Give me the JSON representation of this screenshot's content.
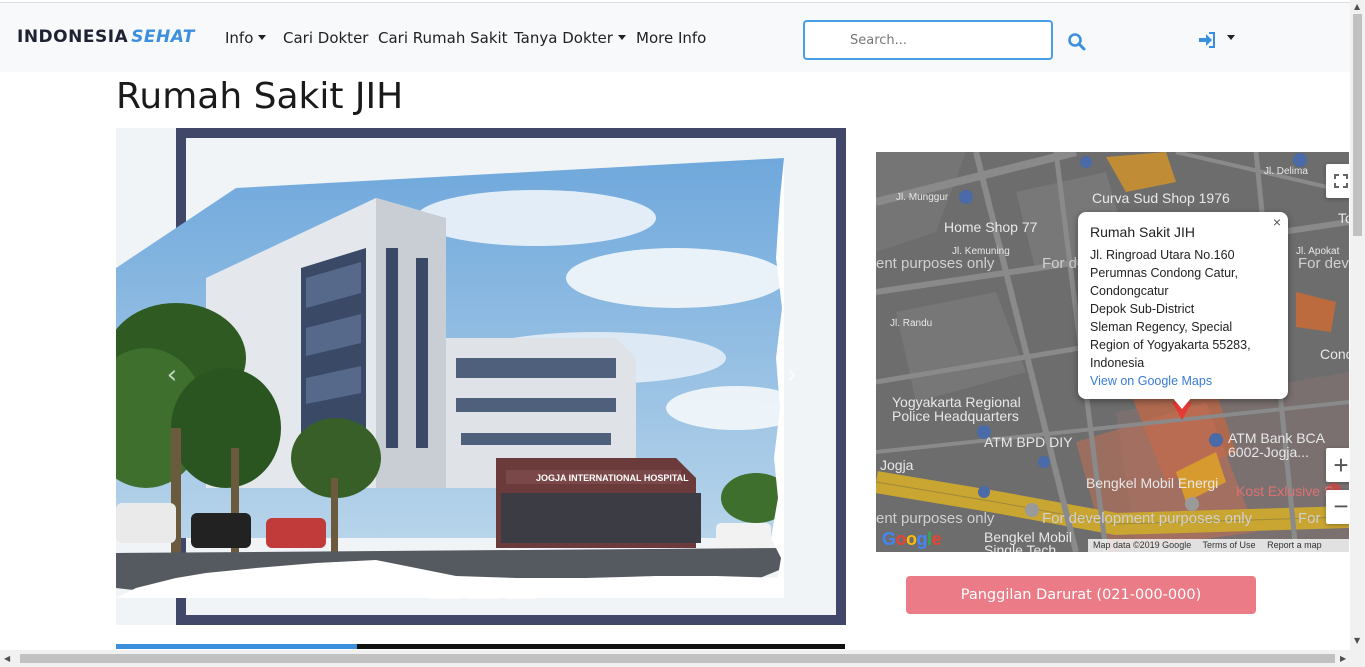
{
  "navbar": {
    "brand_part1": "INDONESIA",
    "brand_part2": "SEHAT",
    "items": [
      {
        "label": "Info",
        "dropdown": true
      },
      {
        "label": "Cari Dokter",
        "dropdown": false
      },
      {
        "label": "Cari Rumah Sakit",
        "dropdown": false
      },
      {
        "label": "Tanya Dokter",
        "dropdown": true
      },
      {
        "label": "More Info",
        "dropdown": false
      }
    ],
    "search_placeholder": "Search...",
    "search_icon": "search-icon",
    "login_icon": "sign-in-icon"
  },
  "page": {
    "title": "Rumah Sakit JIH"
  },
  "carousel": {
    "photo_sign": "JOGJA INTERNATIONAL HOSPITAL",
    "prev_icon": "chevron-left-icon",
    "next_icon": "chevron-right-icon",
    "slide_count": 3,
    "active_slide": 1,
    "progress": 0.33
  },
  "map": {
    "labels": {
      "curva": "Curva Sud Shop 1976",
      "delima": "Jl. Delima",
      "munggur": "Jl. Munggur",
      "homeshop": "Home Shop 77",
      "kemuning": "Jl. Kemuning",
      "randu": "Jl. Randu",
      "apokat": "Jl. Apokat",
      "police1": "Yogyakarta Regional",
      "police2": "Police Headquarters",
      "atmbpd": "ATM BPD DIY",
      "atmbca1": "ATM Bank BCA",
      "atmbca2": "6002-Jogja...",
      "jogja": "Jogja",
      "bengkel1": "Bengkel Mobil Energi",
      "bengkel2": "Bengkel Mobil",
      "bengkel2b": "Single Tech",
      "kost": "Kost Exlusive S",
      "conc": "Conc",
      "to": "To",
      "dev1": "ent purposes only",
      "dev2": "For de",
      "dev3": "For dev",
      "dev4": "ent purposes only",
      "dev5": "For development purposes only",
      "dev6": "For"
    },
    "info": {
      "name": "Rumah Sakit JIH",
      "address": "Jl. Ringroad Utara No.160\nPerumnas Condong Catur,\nCondongcatur\nDepok Sub-District\nSleman Regency, Special\nRegion of Yogyakarta 55283,\nIndonesia",
      "link": "View on Google Maps",
      "close": "×"
    },
    "attribution": {
      "data": "Map data ©2019 Google",
      "terms": "Terms of Use",
      "report": "Report a map"
    },
    "logo": "Google",
    "zoom_in": "+",
    "zoom_out": "−",
    "fullscreen_icon": "fullscreen-icon"
  },
  "emergency": {
    "label": "Panggilan Darurat (021-000-000)"
  },
  "colors": {
    "accent": "#3b8fdd",
    "frame": "#414769",
    "emergency": "#ea7b87"
  }
}
